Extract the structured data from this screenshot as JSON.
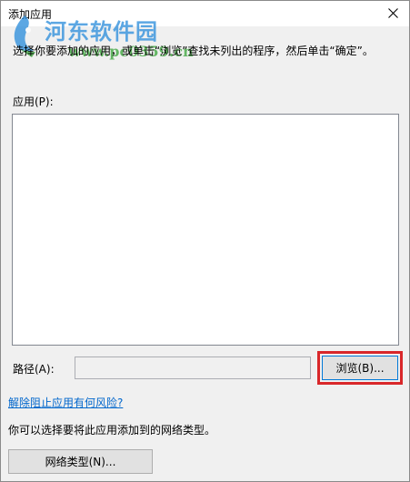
{
  "window": {
    "title": "添加应用"
  },
  "watermark": {
    "site_name": "河东软件园",
    "site_url": "www.pc0359.cn",
    "colors": {
      "name": "#2f8fdc",
      "url": "#3ea73e"
    }
  },
  "instruction": "选择你要添加的应用，或单击“浏览”查找未列出的程序，然后单击“确定”。",
  "apps": {
    "label": "应用(P):",
    "items": []
  },
  "path": {
    "label": "路径(A):",
    "value": "",
    "placeholder": ""
  },
  "buttons": {
    "browse": "浏览(B)...",
    "network_type": "网络类型(N)..."
  },
  "links": {
    "unblock_risk": "解除阻止应用有何风险?"
  },
  "network": {
    "description": "你可以选择要将此应用添加到的网络类型。"
  },
  "colors": {
    "highlight": "#d9272a",
    "link": "#0066cc",
    "focus_border": "#0078d7"
  },
  "icons": {
    "close": "close-icon",
    "watermark_logo": "watermark-logo-icon"
  }
}
